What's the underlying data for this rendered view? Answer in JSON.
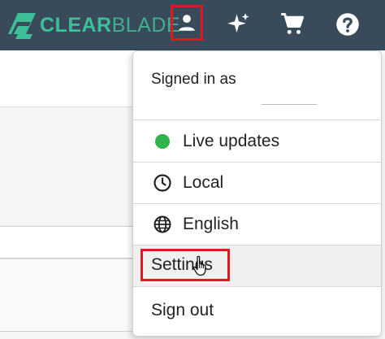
{
  "header": {
    "logo": {
      "bold_part": "CLEAR",
      "light_part": "BLADE"
    },
    "icons": [
      "user-icon",
      "sparkle-icon",
      "cart-icon",
      "help-icon"
    ],
    "accent_color": "#394b5b",
    "highlight_color": "#e01a22"
  },
  "menu": {
    "signed_in_label": "Signed in as",
    "items": [
      {
        "label": "Live updates",
        "icon": "status-dot-icon",
        "status_color": "#2fb44a"
      },
      {
        "label": "Local",
        "icon": "clock-icon"
      },
      {
        "label": "English",
        "icon": "globe-icon"
      },
      {
        "label": "Settings",
        "icon": "",
        "hovered": true
      },
      {
        "label": "Sign out",
        "icon": ""
      }
    ]
  }
}
